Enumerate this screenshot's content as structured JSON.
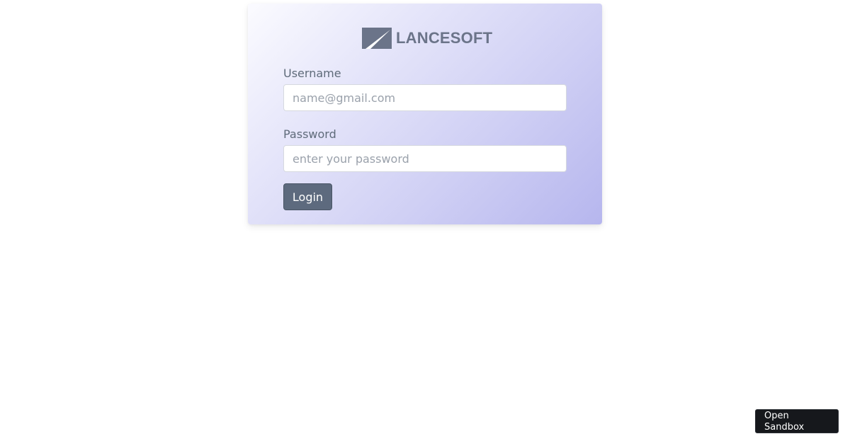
{
  "brand": {
    "name": "LANCESOFT",
    "logo_icon": "lancesoft-logo-icon",
    "color": "#6b7489"
  },
  "form": {
    "username_label": "Username",
    "username_placeholder": "name@gmail.com",
    "username_value": "",
    "password_label": "Password",
    "password_placeholder": "enter your password",
    "password_value": "",
    "login_label": "Login",
    "login_color": "#5d6a7e"
  },
  "sandbox": {
    "label": "Open Sandbox"
  }
}
